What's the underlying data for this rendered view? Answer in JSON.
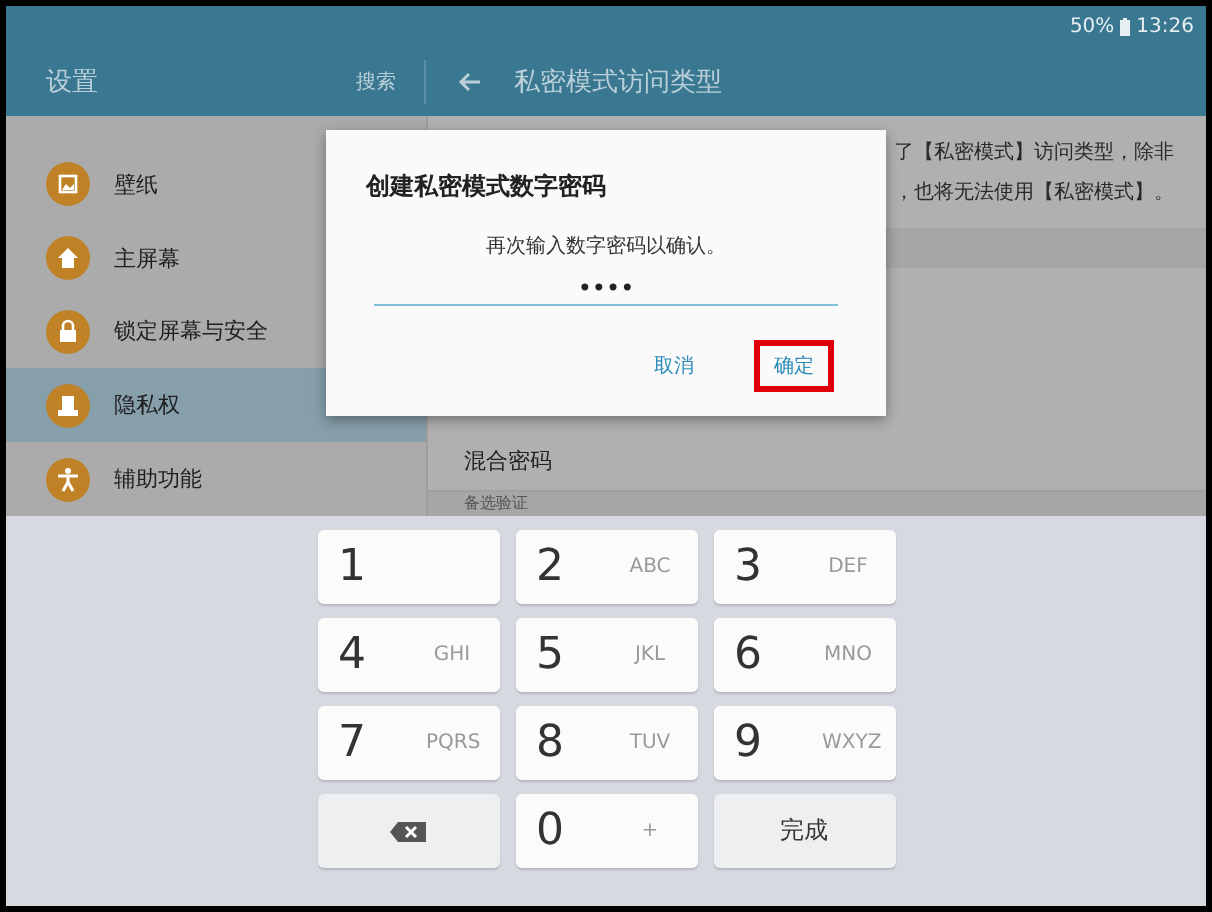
{
  "status_bar": {
    "battery": "50%",
    "time": "13:26"
  },
  "header": {
    "title": "设置",
    "search": "搜索",
    "page_title": "私密模式访问类型"
  },
  "sidebar": {
    "items": [
      {
        "label": "壁纸",
        "selected": false
      },
      {
        "label": "主屏幕",
        "selected": false
      },
      {
        "label": "锁定屏幕与安全",
        "selected": false
      },
      {
        "label": "隐私权",
        "selected": true
      },
      {
        "label": "辅助功能",
        "selected": false
      }
    ]
  },
  "content": {
    "description": [
      "了【私密模式】访问类型，除非",
      "，也将无法使用【私密模式】。"
    ],
    "rows": [
      "混合密码"
    ],
    "section": "备选验证"
  },
  "dialog": {
    "title": "创建私密模式数字密码",
    "message": "再次输入数字密码以确认。",
    "value": "••••",
    "buttons": [
      {
        "label": "取消",
        "highlighted": false
      },
      {
        "label": "确定",
        "highlighted": true
      }
    ]
  },
  "keypad": [
    {
      "kind": "digit",
      "label": "1"
    },
    {
      "kind": "digit",
      "label": "2",
      "letters": "ABC"
    },
    {
      "kind": "digit",
      "label": "3",
      "letters": "DEF"
    },
    {
      "kind": "digit",
      "label": "4",
      "letters": "GHI"
    },
    {
      "kind": "digit",
      "label": "5",
      "letters": "JKL"
    },
    {
      "kind": "digit",
      "label": "6",
      "letters": "MNO"
    },
    {
      "kind": "digit",
      "label": "7",
      "letters": "PQRS"
    },
    {
      "kind": "digit",
      "label": "8",
      "letters": "TUV"
    },
    {
      "kind": "digit",
      "label": "9",
      "letters": "WXYZ"
    },
    {
      "kind": "backspace"
    },
    {
      "kind": "digit",
      "label": "0",
      "letters": "+"
    },
    {
      "kind": "action",
      "label": "完成"
    }
  ]
}
